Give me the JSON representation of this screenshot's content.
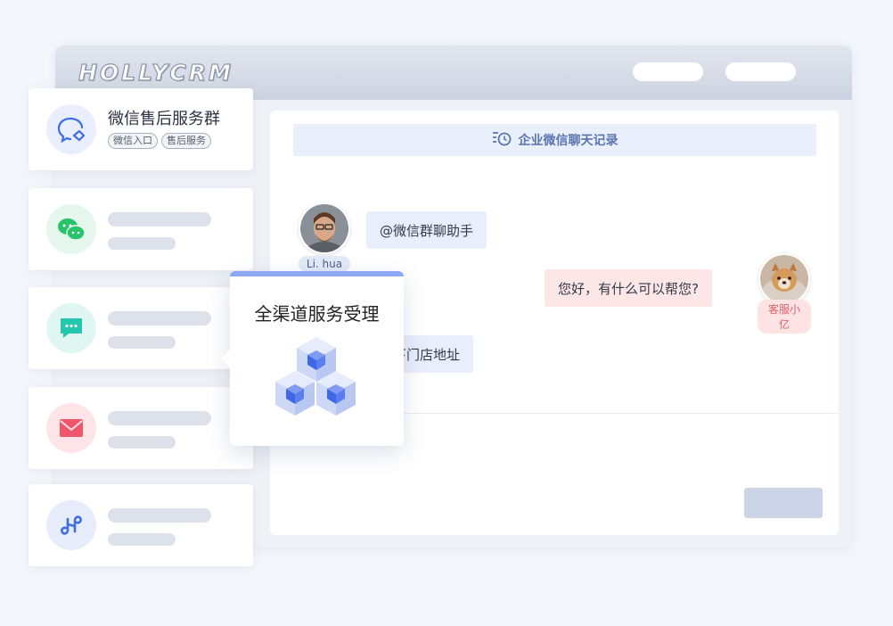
{
  "app": {
    "logo": "HOLLYCRM"
  },
  "chat": {
    "header_label": "企业微信聊天记录",
    "messages": [
      {
        "sender": "Li. hua",
        "text": "@微信群聊助手"
      },
      {
        "sender": "客服小亿",
        "text": "您好，有什么可以帮您?"
      },
      {
        "sender": "Li. hua",
        "text": "的下门店地址"
      }
    ]
  },
  "channels": {
    "first": {
      "title": "微信售后服务群",
      "tags": [
        "微信入口",
        "售后服务"
      ]
    }
  },
  "popup": {
    "title": "全渠道服务受理"
  },
  "icons": {
    "record": "history-clock-icon",
    "channel_1": "chat-support-icon",
    "channel_2": "wechat-icon",
    "channel_3": "message-icon",
    "channel_4": "mail-icon",
    "channel_5": "mini-program-icon",
    "popup": "cubes-icon"
  },
  "colors": {
    "accent": "#8ea8f5",
    "bubble_blue": "#e8eefb",
    "bubble_pink": "#fce6e6",
    "wechat_green": "#28c26a",
    "message_teal": "#25c6b0",
    "mail_red": "#f0566a",
    "link_blue": "#3d6de8"
  }
}
